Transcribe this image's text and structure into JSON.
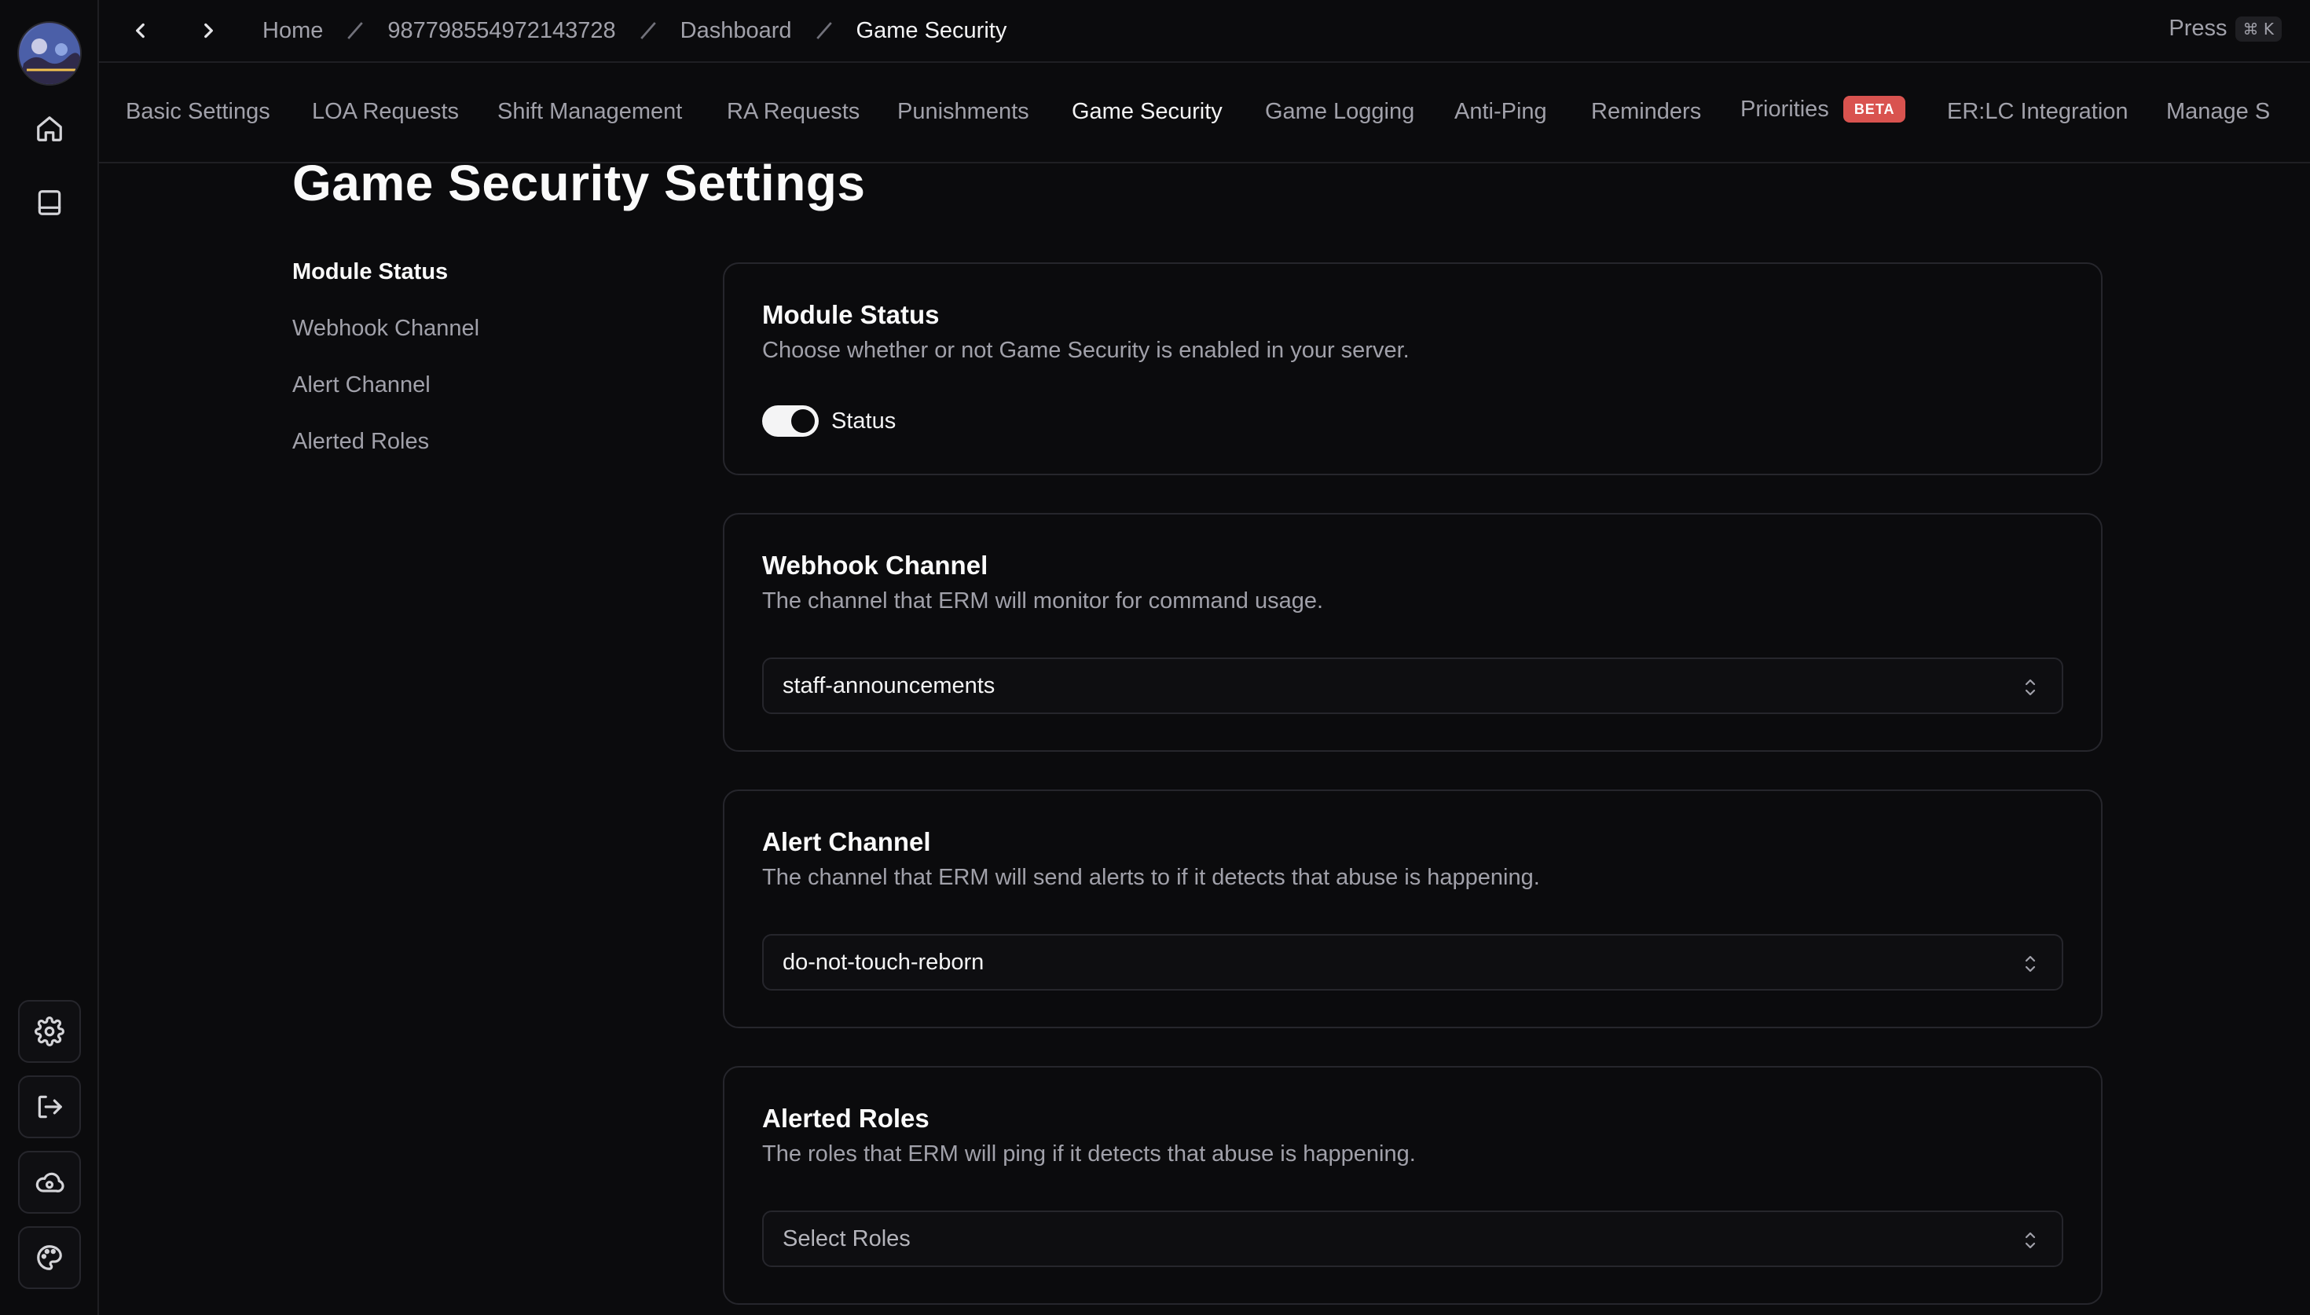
{
  "breadcrumb": {
    "items": [
      "Home",
      "987798554972143728",
      "Dashboard",
      "Game Security"
    ]
  },
  "command_hint": {
    "label": "Press",
    "shortcut": "⌘ K"
  },
  "tabs": [
    {
      "label": "Basic Settings"
    },
    {
      "label": "LOA Requests"
    },
    {
      "label": "Shift Management"
    },
    {
      "label": "RA Requests"
    },
    {
      "label": "Punishments"
    },
    {
      "label": "Game Security",
      "active": true
    },
    {
      "label": "Game Logging"
    },
    {
      "label": "Anti-Ping"
    },
    {
      "label": "Reminders"
    },
    {
      "label": "Priorities",
      "badge": "BETA"
    },
    {
      "label": "ER:LC Integration"
    },
    {
      "label": "Manage S"
    }
  ],
  "page": {
    "title": "Game Security Settings"
  },
  "side_nav": [
    "Module Status",
    "Webhook Channel",
    "Alert Channel",
    "Alerted Roles"
  ],
  "sections": {
    "module_status": {
      "title": "Module Status",
      "description": "Choose whether or not Game Security is enabled in your server.",
      "toggle_label": "Status",
      "enabled": true
    },
    "webhook_channel": {
      "title": "Webhook Channel",
      "description": "The channel that ERM will monitor for command usage.",
      "value": "staff-announcements"
    },
    "alert_channel": {
      "title": "Alert Channel",
      "description": "The channel that ERM will send alerts to if it detects that abuse is happening.",
      "value": "do-not-touch-reborn"
    },
    "alerted_roles": {
      "title": "Alerted Roles",
      "description": "The roles that ERM will ping if it detects that abuse is happening.",
      "placeholder": "Select Roles"
    }
  },
  "icons": {
    "rail": [
      "home-icon",
      "book-icon",
      "gear-icon",
      "logout-icon",
      "cloud-sync-icon",
      "palette-icon"
    ]
  },
  "colors": {
    "background": "#0b0b0d",
    "beta_badge": "#d9534f",
    "border": "#26262c"
  }
}
